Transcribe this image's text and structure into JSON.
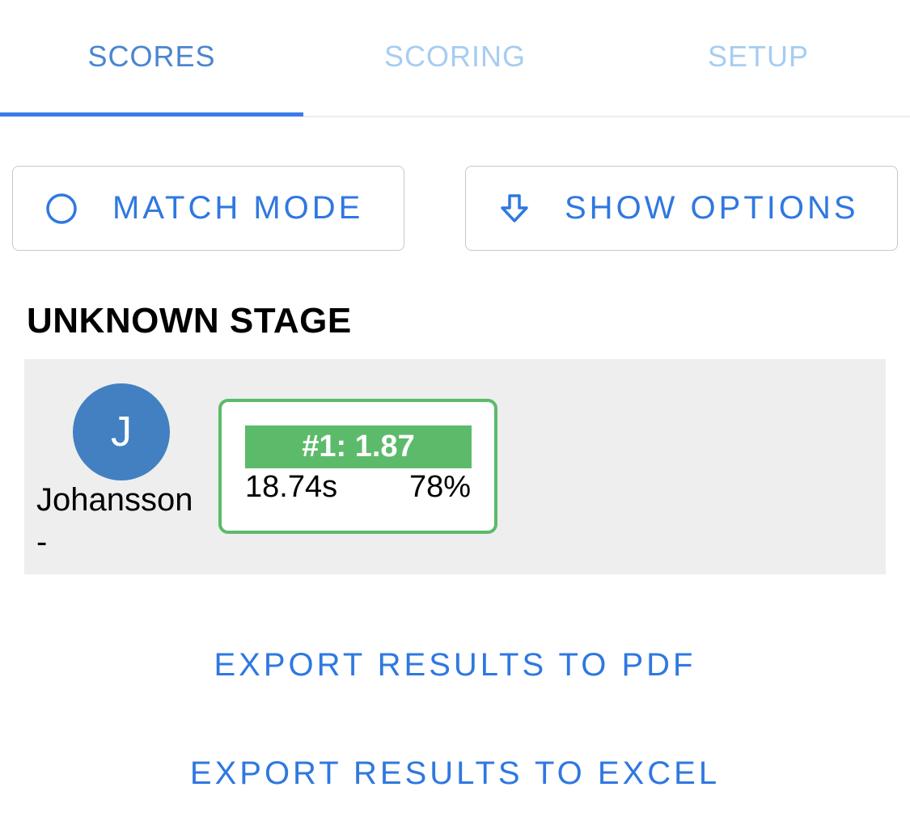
{
  "tabs": [
    {
      "label": "SCORES",
      "active": true
    },
    {
      "label": "SCORING",
      "active": false
    },
    {
      "label": "SETUP",
      "active": false
    }
  ],
  "buttons": {
    "match_mode": {
      "label": "MATCH MODE",
      "icon": "radio-unchecked-icon"
    },
    "show_options": {
      "label": "SHOW OPTIONS",
      "icon": "arrow-down-icon"
    }
  },
  "stage": {
    "title": "UNKNOWN STAGE",
    "competitor": {
      "initial": "J",
      "name": "Johansson",
      "sub": "-"
    },
    "score": {
      "rank_label": "#1: 1.87",
      "time": "18.74s",
      "percent": "78%"
    }
  },
  "exports": {
    "pdf": "EXPORT RESULTS TO PDF",
    "excel": "EXPORT RESULTS TO EXCEL"
  },
  "colors": {
    "accent": "#2f78e0",
    "tab_active": "#4a86cf",
    "tab_inactive": "#a6cdf0",
    "success": "#5cbb6a",
    "avatar": "#4380c2",
    "panel": "#eeeeee"
  }
}
